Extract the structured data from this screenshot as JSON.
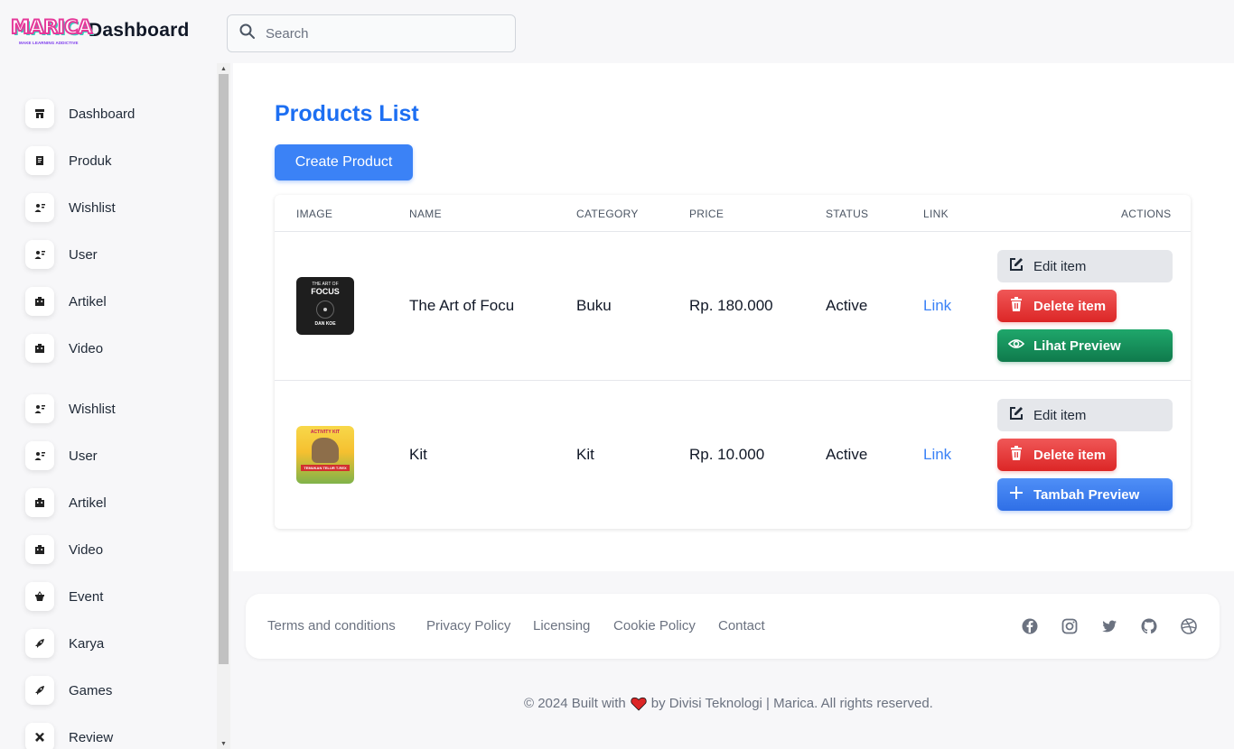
{
  "header": {
    "logo_text": "MARICA",
    "logo_tagline": "MAKE LEARNING ADDICTIVE",
    "title": "Dashboard",
    "search_placeholder": "Search"
  },
  "sidebar": {
    "items": [
      {
        "label": "Dashboard",
        "icon": "shop-icon"
      },
      {
        "label": "Produk",
        "icon": "document-icon"
      },
      {
        "label": "Wishlist",
        "icon": "user-list-icon"
      },
      {
        "label": "User",
        "icon": "user-list-icon"
      },
      {
        "label": "Artikel",
        "icon": "building-icon"
      },
      {
        "label": "Video",
        "icon": "building-icon"
      },
      {
        "label": "Wishlist",
        "icon": "user-list-icon"
      },
      {
        "label": "User",
        "icon": "user-list-icon"
      },
      {
        "label": "Artikel",
        "icon": "building-icon"
      },
      {
        "label": "Video",
        "icon": "building-icon"
      },
      {
        "label": "Event",
        "icon": "basket-icon"
      },
      {
        "label": "Karya",
        "icon": "rocket-icon"
      },
      {
        "label": "Games",
        "icon": "rocket-icon"
      },
      {
        "label": "Review",
        "icon": "tools-icon"
      }
    ]
  },
  "main": {
    "title": "Products List",
    "create_button": "Create Product",
    "columns": [
      "IMAGE",
      "NAME",
      "CATEGORY",
      "PRICE",
      "STATUS",
      "LINK",
      "ACTIONS"
    ],
    "rows": [
      {
        "image_title_small": "THE ART OF",
        "image_title_big": "FOCUS",
        "image_author": "DAN KOE",
        "name": "The Art of Focu",
        "category": "Buku",
        "price": "Rp. 180.000",
        "status": "Active",
        "link": "Link",
        "actions": {
          "edit": "Edit item",
          "delete": "Delete item",
          "preview": "Lihat Preview"
        }
      },
      {
        "image_title_small": "ACTIVITY KIT",
        "image_caption": "TEMUKAN TELUR T-REX",
        "name": "Kit",
        "category": "Kit",
        "price": "Rp. 10.000",
        "status": "Active",
        "link": "Link",
        "actions": {
          "edit": "Edit item",
          "delete": "Delete item",
          "preview": "Tambah Preview"
        }
      }
    ]
  },
  "footer": {
    "links": [
      "Terms and conditions",
      "Privacy Policy",
      "Licensing",
      "Cookie Policy",
      "Contact"
    ],
    "socials": [
      "facebook-icon",
      "instagram-icon",
      "twitter-icon",
      "github-icon",
      "dribbble-icon"
    ],
    "copyright_before": "© 2024 Built with",
    "copyright_after": "by Divisi Teknologi | Marica. All rights reserved."
  },
  "colors": {
    "primary": "#3b82f6",
    "title_blue": "#1d6ff2",
    "delete_red": "#dc2626",
    "preview_green": "#0f7a4c",
    "heart_red": "#dc2626"
  }
}
